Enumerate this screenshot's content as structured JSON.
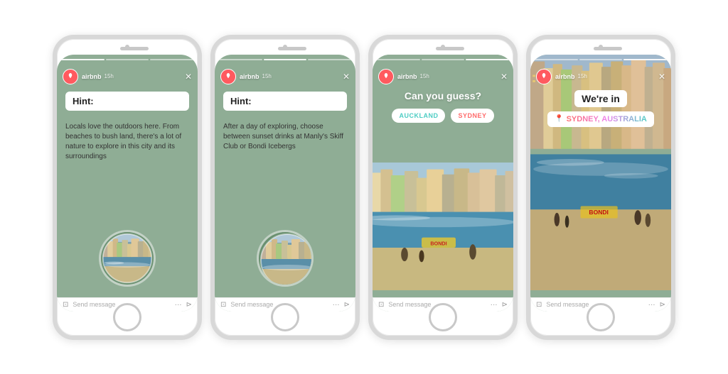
{
  "phones": [
    {
      "id": "phone-1",
      "screen_type": "hint-green",
      "header": {
        "user": "airbnb",
        "time": "15h"
      },
      "hint_label": "Hint:",
      "hint_text": "Locals love the outdoors here. From beaches to bush land, there's a lot of nature to explore in this city and its surroundings",
      "footer": {
        "placeholder": "Send message"
      }
    },
    {
      "id": "phone-2",
      "screen_type": "hint-green",
      "header": {
        "user": "airbnb",
        "time": "15h"
      },
      "hint_label": "Hint:",
      "hint_text": "After a day of exploring, choose between sunset drinks at Manly's Skiff Club or Bondi Icebergs",
      "footer": {
        "placeholder": "Send message"
      }
    },
    {
      "id": "phone-3",
      "screen_type": "guess",
      "header": {
        "user": "airbnb",
        "time": "15h"
      },
      "guess_title": "Can you guess?",
      "options": [
        "AUCKLAND",
        "SYDNEY"
      ],
      "footer": {
        "placeholder": "Send message"
      }
    },
    {
      "id": "phone-4",
      "screen_type": "answer",
      "header": {
        "user": "airbnb",
        "time": "15h"
      },
      "were_in": "We're in",
      "location_pin": "📍",
      "location": "SYDNEY, AUSTRALIA",
      "footer": {
        "placeholder": "Send message"
      }
    }
  ],
  "icons": {
    "close": "✕",
    "camera": "📷",
    "dots": "···",
    "send": "➤"
  }
}
